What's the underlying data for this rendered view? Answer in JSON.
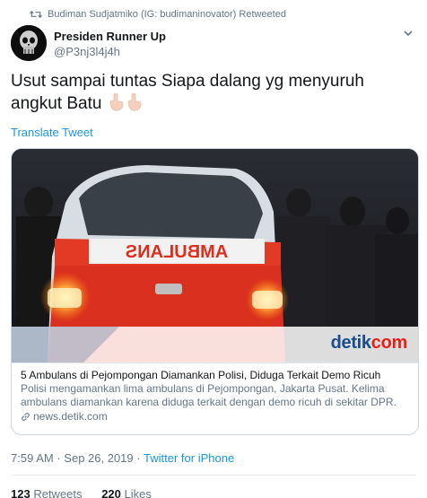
{
  "retweet": {
    "text": "Budiman Sudjatmiko (IG: budimaninovator) Retweeted"
  },
  "author": {
    "name": "Presiden Runner Up",
    "handle": "@P3nj3l4j4h"
  },
  "tweet": {
    "text": "Usut sampai tuntas Siapa dalang yg menyuruh angkut Batu"
  },
  "translate_label": "Translate Tweet",
  "card": {
    "image_text": "AMBULANS",
    "brand": "detikcom",
    "brand_accent_color": "#e2231a",
    "brand_color": "#1a4b8c",
    "title": "5 Ambulans di Pejompongan Diamankan Polisi, Diduga Terkait Demo Ricuh",
    "description": "Polisi mengamankan lima ambulans di Pejompongan, Jakarta Pusat. Kelima ambulans diamankan karena diduga terkait dengan demo ricuh di sekitar DPR.",
    "domain": "news.detik.com"
  },
  "meta": {
    "time": "7:59 AM",
    "date": "Sep 26, 2019",
    "separator": "·",
    "source": "Twitter for iPhone"
  },
  "stats": {
    "retweets_count": "123",
    "retweets_label": "Retweets",
    "likes_count": "220",
    "likes_label": "Likes"
  },
  "colors": {
    "link": "#1b95e0",
    "secondary_text": "#657786",
    "primary_text": "#14171a"
  }
}
